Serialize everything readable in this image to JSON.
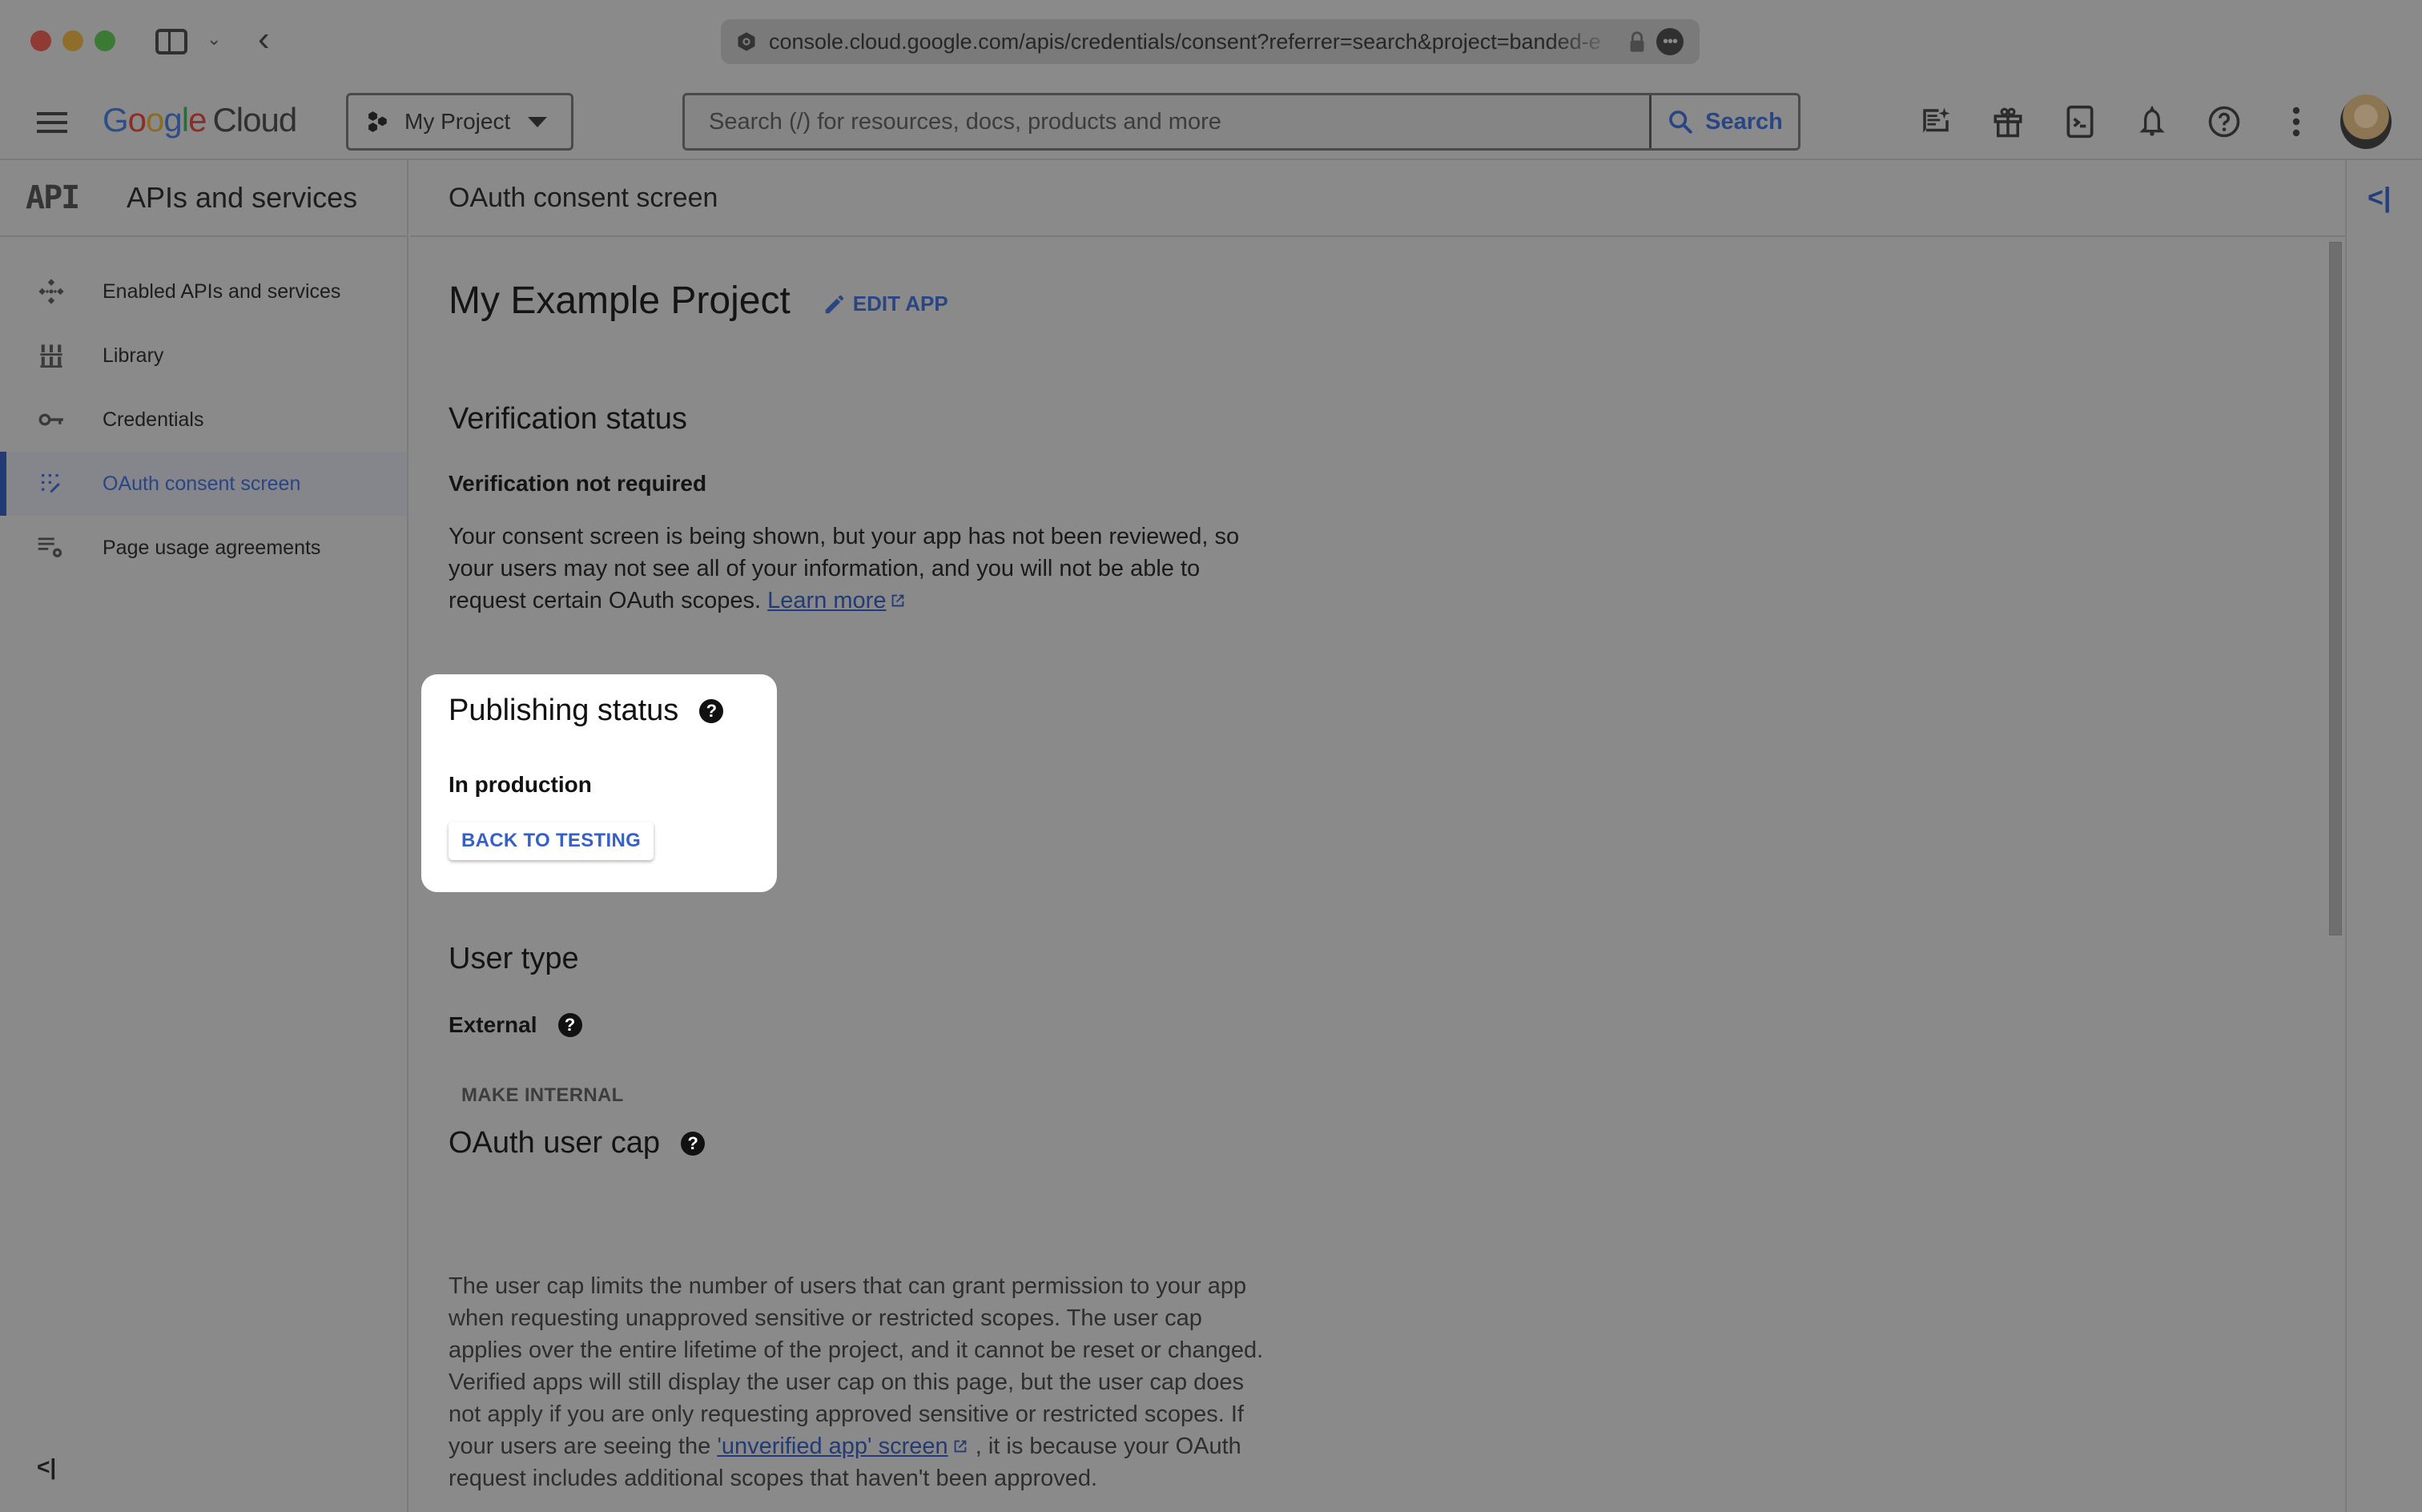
{
  "browser": {
    "url": "console.cloud.google.com/apis/credentials/consent?referrer=search&project=banded-e"
  },
  "topbar": {
    "logo_parts": [
      "G",
      "o",
      "o",
      "g",
      "l",
      "e"
    ],
    "logo_product": "Cloud",
    "project_name": "My Project",
    "search_placeholder": "Search (/) for resources, docs, products and more",
    "search_button": "Search",
    "icons": [
      "gemini-chat-icon",
      "gift-icon",
      "cloud-shell-icon",
      "notifications-icon",
      "help-icon",
      "more-vert-icon"
    ]
  },
  "leftnav": {
    "logo": "API",
    "title": "APIs and services",
    "items": [
      {
        "label": "Enabled APIs and services",
        "icon": "enabled-apis-icon",
        "active": false
      },
      {
        "label": "Library",
        "icon": "library-icon",
        "active": false
      },
      {
        "label": "Credentials",
        "icon": "key-icon",
        "active": false
      },
      {
        "label": "OAuth consent screen",
        "icon": "oauth-consent-icon",
        "active": true
      },
      {
        "label": "Page usage agreements",
        "icon": "usage-settings-icon",
        "active": false
      }
    ],
    "collapse_label": "<|"
  },
  "content": {
    "header_title": "OAuth consent screen",
    "app_name": "My Example Project",
    "edit_app_label": "EDIT APP",
    "verification": {
      "heading": "Verification status",
      "status": "Verification not required",
      "description": "Your consent screen is being shown, but your app has not been reviewed, so your users may not see all of your information, and you will not be able to request certain OAuth scopes.",
      "link_label": "Learn more"
    },
    "publishing": {
      "heading": "Publishing status",
      "status": "In production",
      "button_label": "BACK TO TESTING"
    },
    "user_type": {
      "heading": "User type",
      "value": "External",
      "button_label": "MAKE INTERNAL"
    },
    "user_cap": {
      "heading": "OAuth user cap",
      "description_before": "The user cap limits the number of users that can grant permission to your app when requesting unapproved sensitive or restricted scopes. The user cap applies over the entire lifetime of the project, and it cannot be reset or changed. Verified apps will still display the user cap on this page, but the user cap does not apply if you are only requesting approved sensitive or restricted scopes. If your users are seeing the",
      "link_label": "'unverified app' screen",
      "description_after": ", it is because your OAuth request includes additional scopes that haven't been approved."
    }
  },
  "right_rail": {
    "toggle_label": "<|"
  },
  "colors": {
    "overlay_bg": "#8a8a8a",
    "accent": "#2a4583",
    "spotlight_button_text": "#3760c6",
    "spotlight_bg": "#ffffff"
  }
}
